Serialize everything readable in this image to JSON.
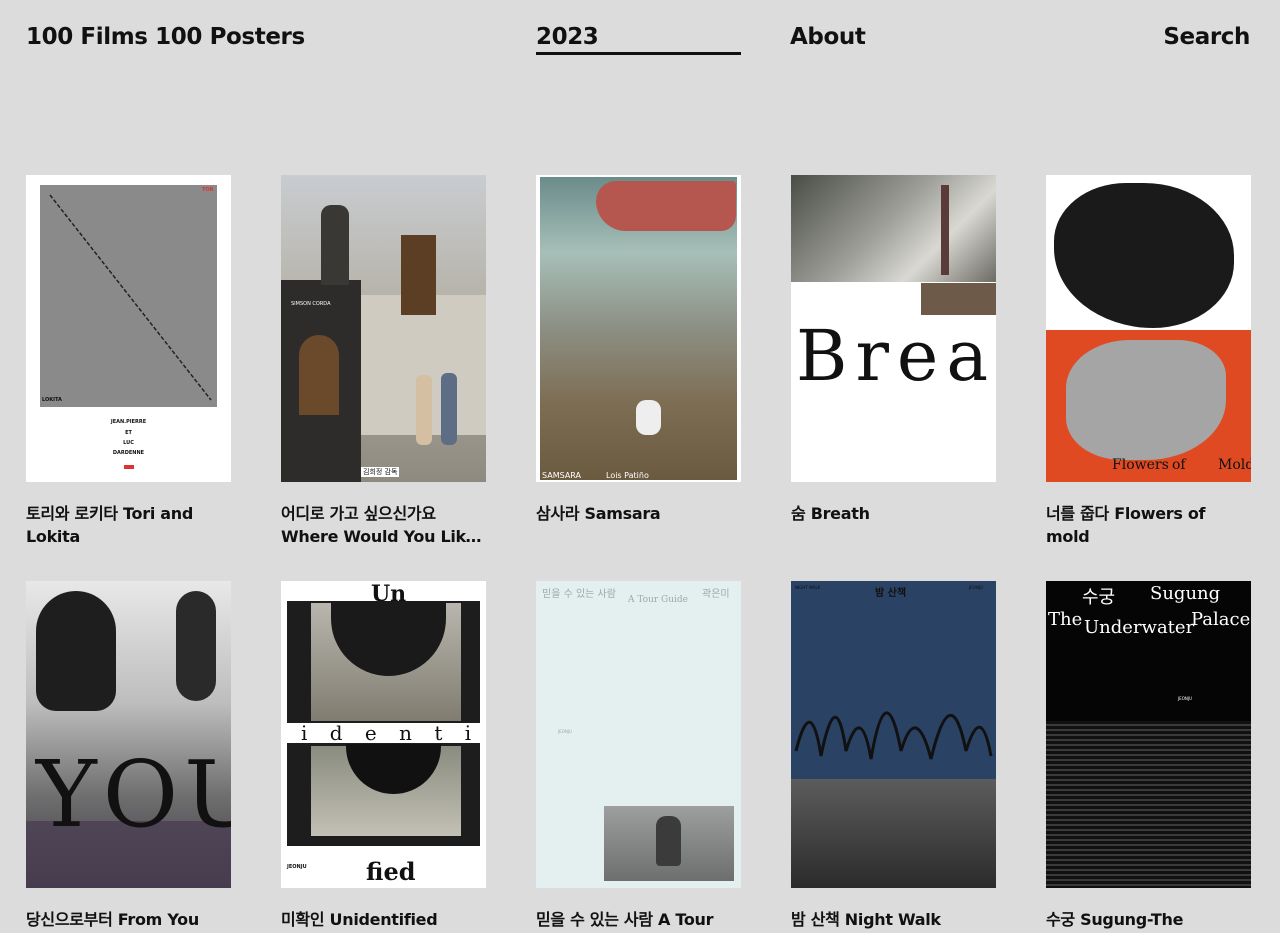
{
  "nav": {
    "brand": "100 Films 100 Posters",
    "year": "2023",
    "about": "About",
    "search": "Search"
  },
  "films": [
    {
      "title": "토리와 로키타 Tori and Lokita",
      "poster_text": {
        "top": "TOR",
        "name": "LOKITA",
        "credits": "JEAN.PIERRE",
        "et": "ET",
        "luc": "LUC",
        "dardenne": "DARDENNE"
      }
    },
    {
      "title": "어디로 가고 싶으신가요 Where Would You Like To Go?",
      "poster_text": {
        "sign": "SIMSON CORDA",
        "director": "김희정 감독"
      }
    },
    {
      "title": "삼사라 Samsara",
      "poster_text": {
        "left": "SAMSARA",
        "right": "Lois Patiño"
      }
    },
    {
      "title": "숨 Breath",
      "poster_text": {
        "word": "Breath"
      }
    },
    {
      "title": "너를 줍다 Flowers of mold",
      "poster_text": {
        "left": "Flowers",
        "mid": "of",
        "right": "Mold"
      }
    },
    {
      "title": "당신으로부터 From You",
      "poster_text": {
        "word": "YOU"
      }
    },
    {
      "title": "미확인 Unidentified",
      "poster_text": {
        "top": "Un",
        "mid": "i d e n t i",
        "bottom": "fied",
        "fest": "JEONJU"
      }
    },
    {
      "title": "믿을 수 있는 사람 A Tour Guide",
      "poster_text": {
        "kr": "믿을 수 있는 사람",
        "director": "곽은미",
        "en": "A Tour Guide",
        "fest": "JEONJU"
      }
    },
    {
      "title": "밤 산책 Night Walk",
      "poster_text": {
        "kr": "밤 산책",
        "left": "NIGHT WALK",
        "right": "JEONJU"
      }
    },
    {
      "title": "수궁 Sugung-The Underwater Palace",
      "poster_text": {
        "l1a": "수궁",
        "l1b": "Sugung",
        "l2a": "The",
        "l2b": "Underwater",
        "l2c": "Palace",
        "fest": "JEONJU"
      }
    }
  ],
  "colors": {
    "background": "#dcdcdc",
    "text": "#111111"
  }
}
